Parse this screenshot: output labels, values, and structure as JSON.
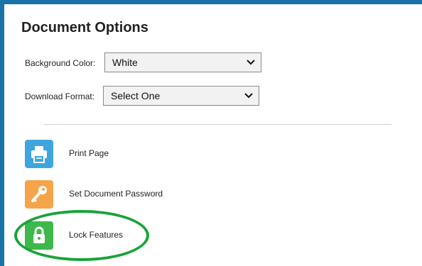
{
  "panel": {
    "title": "Document Options"
  },
  "background_color": {
    "label": "Background Color:",
    "value": "White"
  },
  "download_format": {
    "label": "Download Format:",
    "value": "Select One"
  },
  "actions": [
    {
      "label": "Print Page",
      "icon": "printer-icon",
      "color": "#3fa6dd"
    },
    {
      "label": "Set Document Password",
      "icon": "key-icon",
      "color": "#f5a44a"
    },
    {
      "label": "Lock Features",
      "icon": "lock-icon",
      "color": "#3db84a"
    }
  ],
  "colors": {
    "frame": "#1a73a8",
    "highlight": "#19a33a"
  }
}
